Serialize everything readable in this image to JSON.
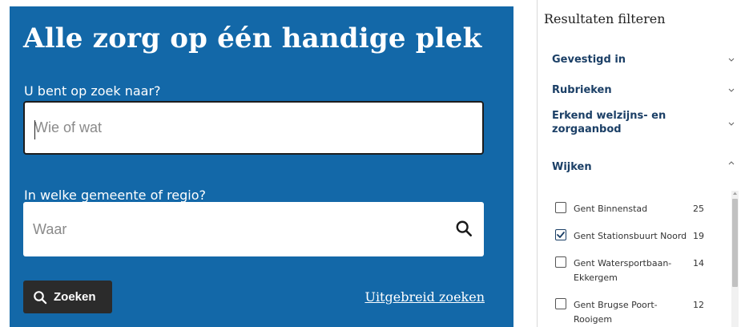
{
  "search": {
    "title": "Alle zorg op één handige plek",
    "what_label": "U bent op zoek naar?",
    "what_placeholder": "Wie of wat",
    "where_label": "In welke gemeente of regio?",
    "where_placeholder": "Waar",
    "submit_label": "Zoeken",
    "advanced_link": "Uitgebreid zoeken"
  },
  "filters": {
    "title": "Resultaten filteren",
    "sections": [
      {
        "label": "Gevestigd in",
        "expanded": false
      },
      {
        "label": "Rubrieken",
        "expanded": false
      },
      {
        "label": "Erkend welzijns- en zorgaanbod",
        "expanded": false
      },
      {
        "label": "Wijken",
        "expanded": true
      }
    ],
    "wijken": [
      {
        "label": "Gent Binnenstad",
        "count": "25",
        "checked": false
      },
      {
        "label": "Gent Stationsbuurt Noord",
        "count": "19",
        "checked": true
      },
      {
        "label": "Gent Watersportbaan-Ekkergem",
        "count": "14",
        "checked": false
      },
      {
        "label": "Gent Brugse Poort-Rooigem",
        "count": "12",
        "checked": false
      }
    ]
  },
  "colors": {
    "panel_bg": "#1368a8",
    "button_bg": "#2b2b2b",
    "filter_heading": "#1b3f66"
  }
}
